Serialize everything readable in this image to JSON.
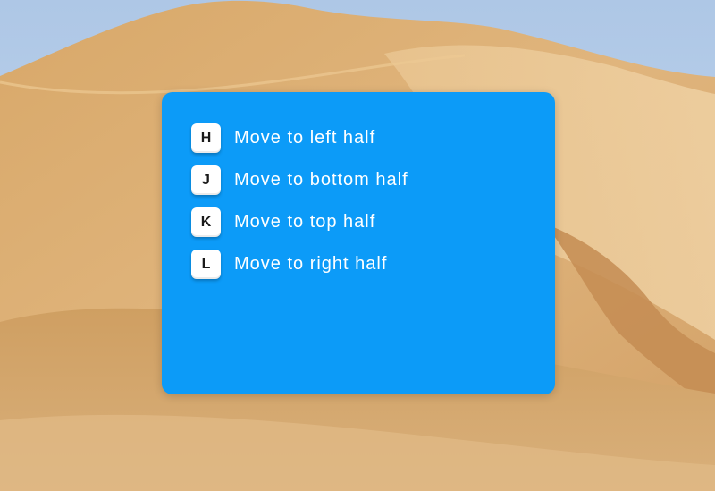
{
  "theme": {
    "panel_color": "#0c9bf8",
    "sky_color": "#b7cee8",
    "sand_color": "#d9ab71",
    "keycap_color": "#ffffff",
    "label_color": "#ffffff"
  },
  "shortcuts": [
    {
      "key": "H",
      "label": "Move to left half"
    },
    {
      "key": "J",
      "label": "Move to bottom half"
    },
    {
      "key": "K",
      "label": "Move to top half"
    },
    {
      "key": "L",
      "label": "Move to right half"
    }
  ]
}
